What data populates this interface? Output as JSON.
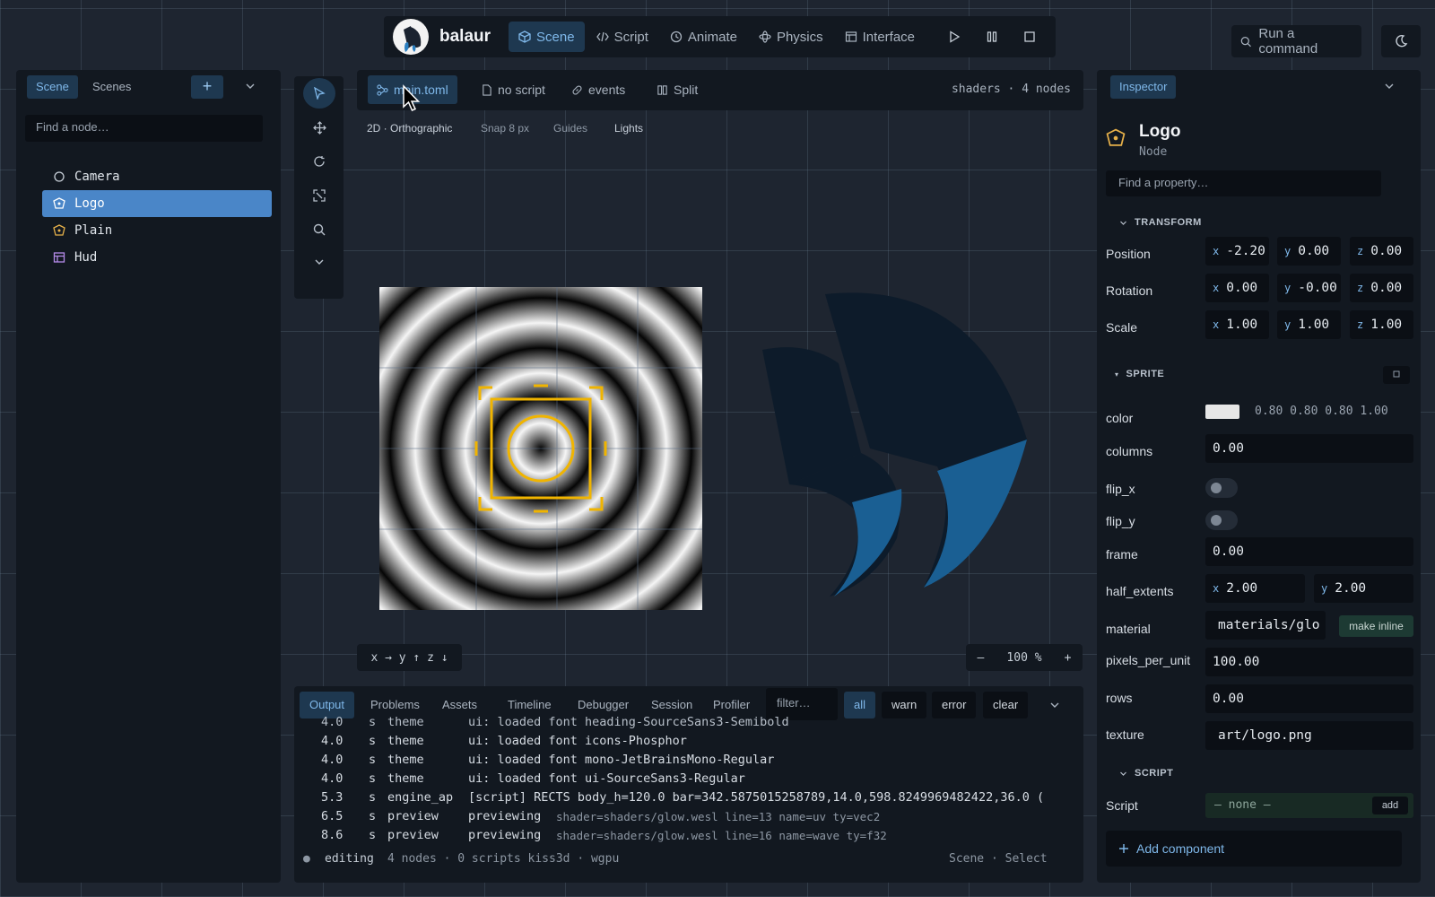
{
  "topbar": {
    "brand": "balaur",
    "nav": [
      {
        "label": "Scene",
        "icon": "cube-icon",
        "active": true
      },
      {
        "label": "Script",
        "icon": "code-icon",
        "active": false
      },
      {
        "label": "Animate",
        "icon": "clock-icon",
        "active": false
      },
      {
        "label": "Physics",
        "icon": "atom-icon",
        "active": false
      },
      {
        "label": "Interface",
        "icon": "layout-icon",
        "active": false
      }
    ],
    "transport": [
      "play-icon",
      "pause-icon",
      "stop-icon"
    ]
  },
  "command": {
    "label": "Run a command"
  },
  "left_panel": {
    "tabs": [
      "Scene",
      "Scenes"
    ],
    "add_label": "+",
    "search_placeholder": "Find a node…",
    "nodes": [
      {
        "name": "Camera",
        "icon": "circle-icon",
        "selected": false
      },
      {
        "name": "Logo",
        "icon": "sprite-node-icon",
        "selected": true
      },
      {
        "name": "Plain",
        "icon": "sprite-node-icon",
        "selected": false
      },
      {
        "name": "Hud",
        "icon": "table-icon",
        "selected": false
      }
    ]
  },
  "tools": [
    "select-arrow-icon",
    "move-icon",
    "rotate-icon",
    "scale-icon",
    "zoom-icon",
    "chevron-down-icon"
  ],
  "viewport": {
    "tabs": [
      {
        "label": "main.toml",
        "icon": "graph-icon",
        "active": true
      },
      {
        "label": "no script",
        "icon": "file-icon",
        "active": false
      },
      {
        "label": "events",
        "icon": "link-icon",
        "active": false
      },
      {
        "label": "Split",
        "icon": "columns-icon",
        "active": false
      }
    ],
    "info": "shaders · 4 nodes",
    "modes": [
      "2D · Orthographic",
      "Snap 8 px",
      "Guides",
      "Lights"
    ],
    "axes": "x → y ↑ z ↓",
    "zoom": {
      "minus": "–",
      "value": "100 %",
      "plus": "+"
    }
  },
  "console": {
    "tabs": [
      "Output",
      "Problems",
      "Assets",
      "Timeline",
      "Debugger",
      "Session",
      "Profiler"
    ],
    "filter_placeholder": "filter…",
    "levels": [
      "all",
      "warn",
      "error",
      "clear"
    ],
    "lines": [
      {
        "time": "4.0",
        "unit": "s",
        "source": "theme",
        "msg": "ui: loaded font heading-SourceSans3-Semibold",
        "extra": ""
      },
      {
        "time": "4.0",
        "unit": "s",
        "source": "theme",
        "msg": "ui: loaded font icons-Phosphor",
        "extra": ""
      },
      {
        "time": "4.0",
        "unit": "s",
        "source": "theme",
        "msg": "ui: loaded font mono-JetBrainsMono-Regular",
        "extra": ""
      },
      {
        "time": "4.0",
        "unit": "s",
        "source": "theme",
        "msg": "ui: loaded font ui-SourceSans3-Regular",
        "extra": ""
      },
      {
        "time": "5.3",
        "unit": "s",
        "source": "engine_ap",
        "msg": "[script] RECTS body_h=120.0 bar=342.5875015258789,14.0,598.8249969482422,36.0 (",
        "extra": ""
      },
      {
        "time": "6.5",
        "unit": "s",
        "source": "preview",
        "msg": "previewing",
        "extra": "shader=shaders/glow.wesl  line=13  name=uv  ty=vec2"
      },
      {
        "time": "8.6",
        "unit": "s",
        "source": "preview",
        "msg": "previewing",
        "extra": "shader=shaders/glow.wesl  line=16  name=wave  ty=f32"
      }
    ],
    "status": {
      "dot": "●",
      "state": "editing",
      "meta": "4 nodes · 0 scripts  kiss3d · wgpu",
      "right": "Scene · Select"
    }
  },
  "inspector": {
    "tab": "Inspector",
    "node_name": "Logo",
    "node_type": "Node",
    "search_placeholder": "Find a property…",
    "transform_title": "TRANSFORM",
    "position": {
      "label": "Position",
      "x": "-2.20",
      "y": "0.00",
      "z": "0.00"
    },
    "rotation": {
      "label": "Rotation",
      "x": "0.00",
      "y": "-0.00",
      "z": "0.00"
    },
    "scale": {
      "label": "Scale",
      "x": "1.00",
      "y": "1.00",
      "z": "1.00"
    },
    "sprite_title": "SPRITE",
    "color": {
      "label": "color",
      "value": "0.80 0.80 0.80 1.00",
      "swatch": "#e6e6e6"
    },
    "columns": {
      "label": "columns",
      "value": "0.00"
    },
    "flip_x": {
      "label": "flip_x",
      "on": false
    },
    "flip_y": {
      "label": "flip_y",
      "on": false
    },
    "frame": {
      "label": "frame",
      "value": "0.00"
    },
    "half_extents": {
      "label": "half_extents",
      "x": "2.00",
      "y": "2.00"
    },
    "material": {
      "label": "material",
      "value": "materials/glo",
      "action": "make inline"
    },
    "pixels_per_unit": {
      "label": "pixels_per_unit",
      "value": "100.00"
    },
    "rows": {
      "label": "rows",
      "value": "0.00"
    },
    "texture": {
      "label": "texture",
      "value": "art/logo.png"
    },
    "script_title": "SCRIPT",
    "script": {
      "label": "Script",
      "value": "— none —",
      "action": "add"
    },
    "add_component": "Add component"
  },
  "colors": {
    "accent": "#4a86c8",
    "active_bg": "#1e3850",
    "selection": "#f0b400",
    "logo_dark": "#0d1b2a",
    "logo_blue": "#1a5f93"
  }
}
